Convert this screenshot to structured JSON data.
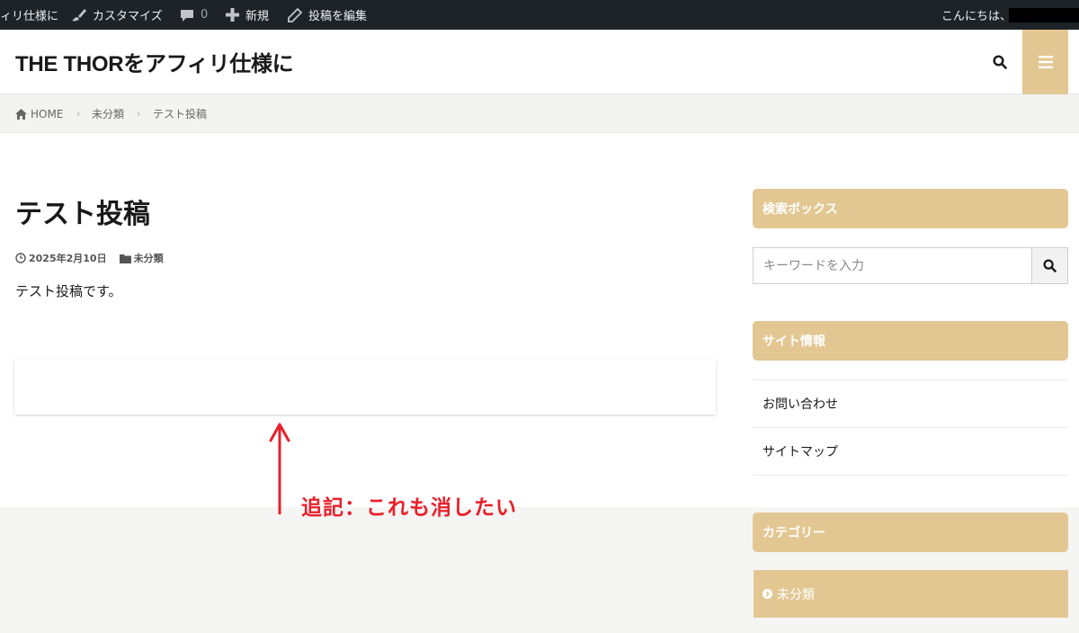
{
  "admin_bar": {
    "site_name": "ィリ仕様に",
    "customize": "カスタマイズ",
    "comments_count": "0",
    "new": "新規",
    "edit_post": "投稿を編集",
    "greeting": "こんにちは、"
  },
  "header": {
    "site_title": "THE THORをアフィリ仕様に"
  },
  "breadcrumb": {
    "items": [
      "HOME",
      "未分類",
      "テスト投稿"
    ]
  },
  "post": {
    "title": "テスト投稿",
    "date": "2025年2月10日",
    "category": "未分類",
    "body": "テスト投稿です。"
  },
  "annotation": {
    "text": "追記：これも消したい",
    "color": "#e8202a"
  },
  "sidebar": {
    "search_widget": {
      "title": "検索ボックス",
      "placeholder": "キーワードを入力"
    },
    "site_info_widget": {
      "title": "サイト情報",
      "links": [
        "お問い合わせ",
        "サイトマップ"
      ]
    },
    "category_widget": {
      "title": "カテゴリー",
      "items": [
        "未分類"
      ]
    }
  },
  "colors": {
    "accent": "#e3c793",
    "admin_bar": "#1d2327"
  }
}
